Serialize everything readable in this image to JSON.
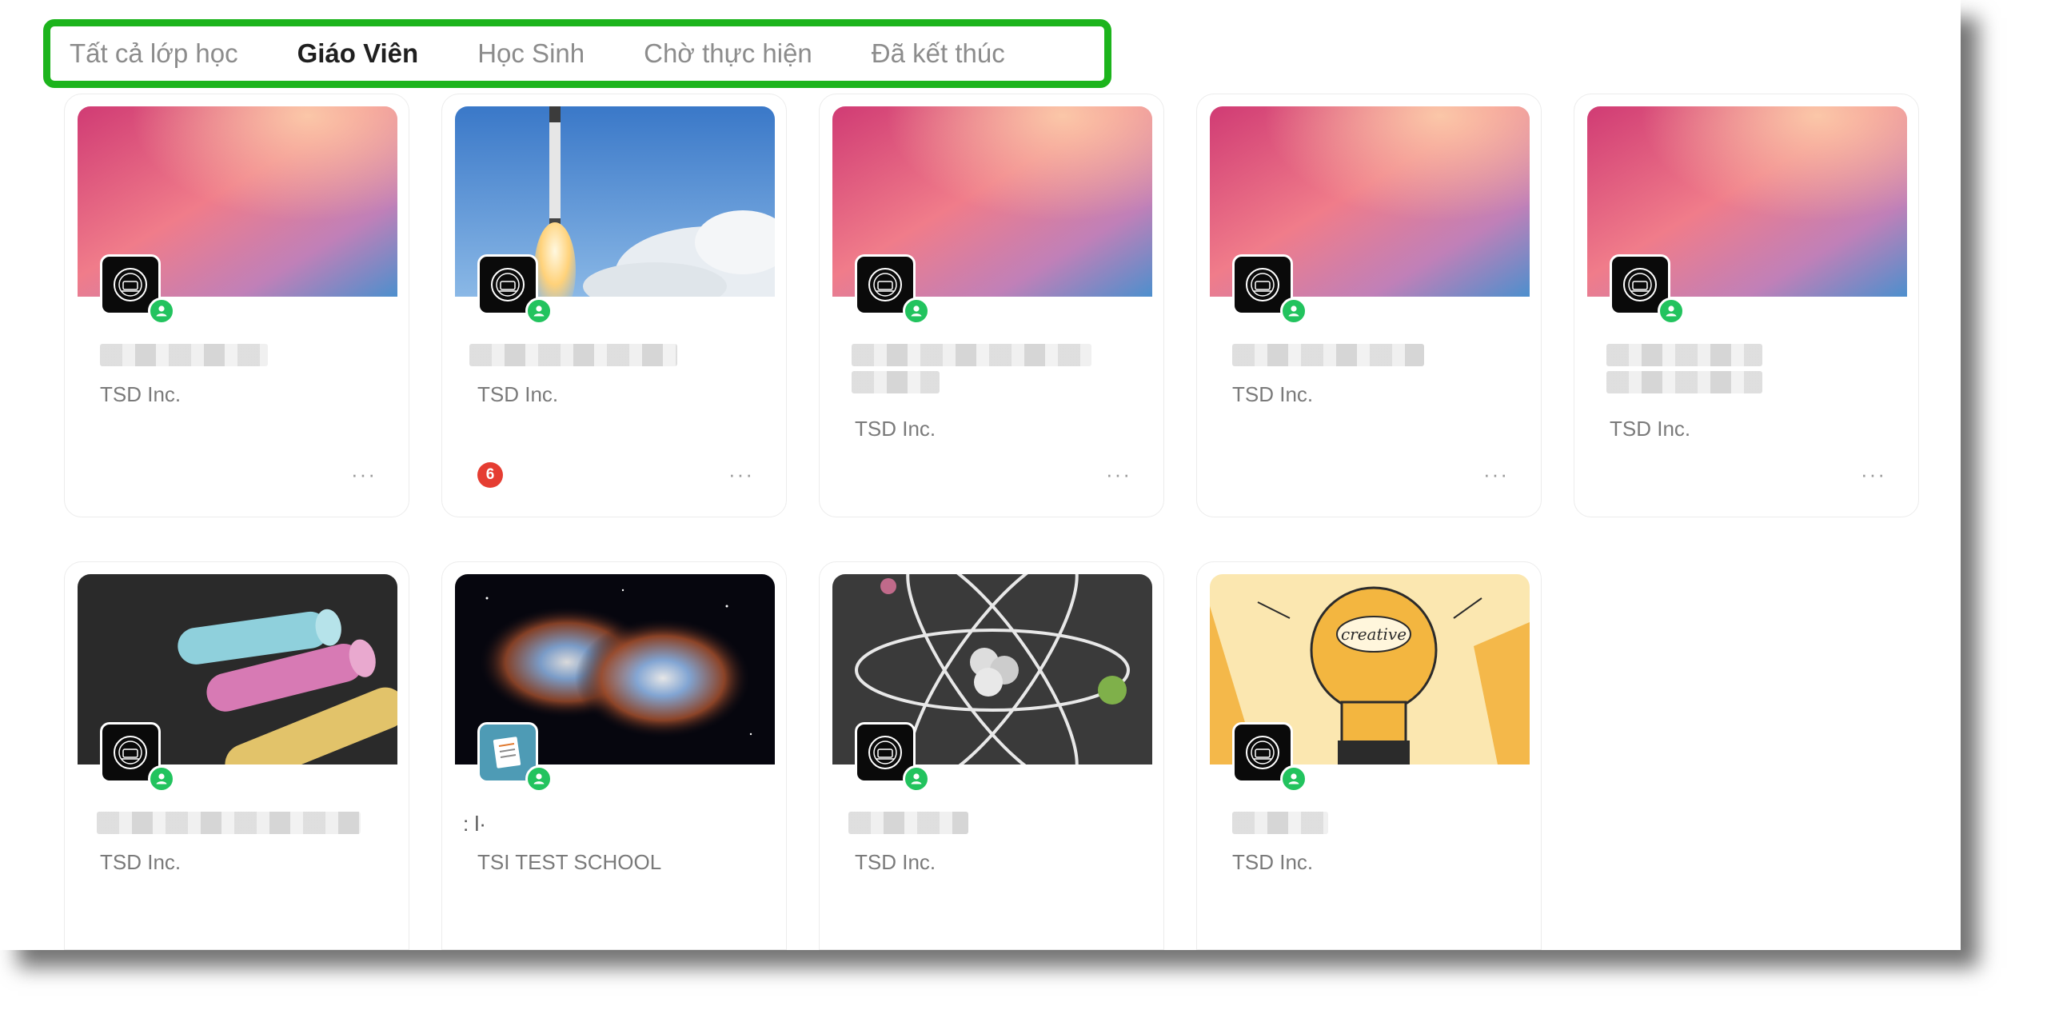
{
  "tabs": [
    {
      "label": "Tất cả lớp học",
      "active": false
    },
    {
      "label": "Giáo Viên",
      "active": true
    },
    {
      "label": "Học Sinh",
      "active": false
    },
    {
      "label": "Chờ thực hiện",
      "active": false
    },
    {
      "label": "Đã kết thúc",
      "active": false
    }
  ],
  "cards": [
    {
      "cover": "gradient",
      "org": "TSD Inc.",
      "more": "···"
    },
    {
      "cover": "rocket",
      "org": "TSD Inc.",
      "badge_count": "6",
      "more": "···"
    },
    {
      "cover": "gradient",
      "org": "TSD Inc.",
      "more": "···"
    },
    {
      "cover": "gradient",
      "org": "TSD Inc.",
      "more": "···"
    },
    {
      "cover": "gradient",
      "org": "TSD Inc.",
      "more": "···"
    },
    {
      "cover": "chalk",
      "org": "TSD Inc."
    },
    {
      "cover": "nebula",
      "org": "TSI TEST SCHOOL",
      "title": ": l·"
    },
    {
      "cover": "atom",
      "org": "TSD Inc."
    },
    {
      "cover": "lightbulb",
      "org": "TSD Inc.",
      "bulb_text": "creative"
    }
  ],
  "colors": {
    "highlight": "#1cb41c",
    "online": "#22c35e",
    "notification": "#e53d32"
  }
}
